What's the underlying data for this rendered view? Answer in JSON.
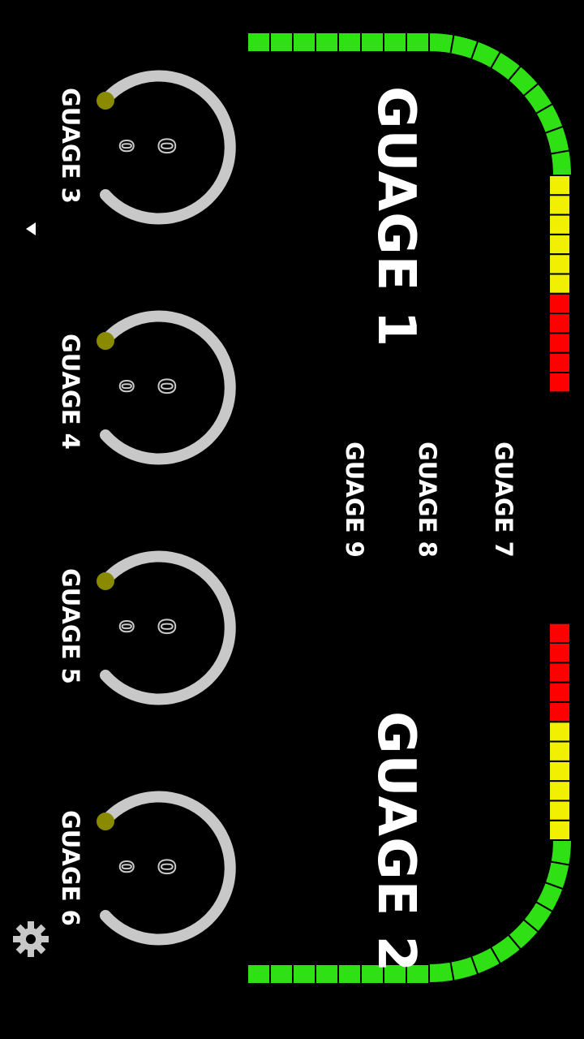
{
  "gauges": {
    "gauge1": {
      "label": "GUAGE 1"
    },
    "gauge2": {
      "label": "GUAGE 2"
    }
  },
  "text_gauges": [
    {
      "label": "GUAGE 7"
    },
    {
      "label": "GUAGE 8"
    },
    {
      "label": "GUAGE 9"
    }
  ],
  "dials": [
    {
      "label": "GUAGE 3",
      "value_main": "0",
      "value_sub": "0"
    },
    {
      "label": "GUAGE 4",
      "value_main": "0",
      "value_sub": "0"
    },
    {
      "label": "GUAGE 5",
      "value_main": "0",
      "value_sub": "0"
    },
    {
      "label": "GUAGE 6",
      "value_main": "0",
      "value_sub": "0"
    }
  ],
  "colors": {
    "background": "#000000",
    "bar_green": "#2ee014",
    "bar_yellow": "#f0f000",
    "bar_red": "#ff0000",
    "dial_ring": "#c8c8c8",
    "dial_knob": "#8a8a00"
  },
  "icons": {
    "settings": "gear-icon",
    "back": "back-arrow-icon"
  }
}
